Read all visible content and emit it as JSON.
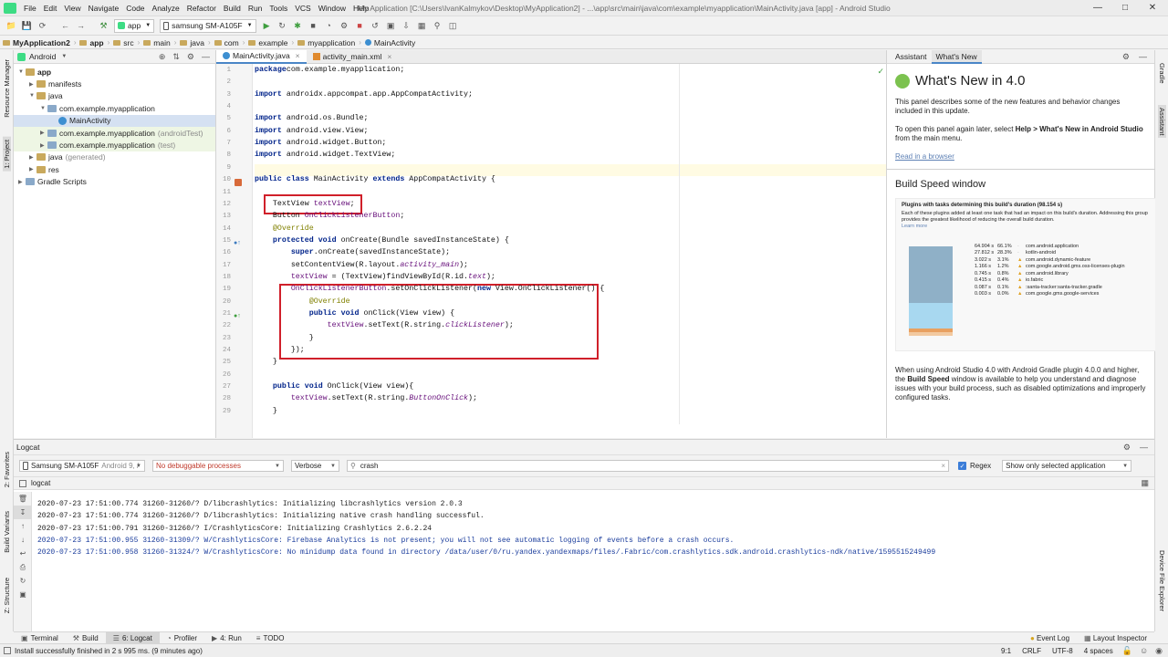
{
  "menu": [
    "File",
    "Edit",
    "View",
    "Navigate",
    "Code",
    "Analyze",
    "Refactor",
    "Build",
    "Run",
    "Tools",
    "VCS",
    "Window",
    "Help"
  ],
  "window_title": "My Application [C:\\Users\\IvanKalmykov\\Desktop\\MyApplication2] - ...\\app\\src\\main\\java\\com\\example\\myapplication\\MainActivity.java [app] - Android Studio",
  "toolbar": {
    "run_config": "app",
    "device": "samsung SM-A105F"
  },
  "breadcrumbs": [
    "MyApplication2",
    "app",
    "src",
    "main",
    "java",
    "com",
    "example",
    "myapplication",
    "MainActivity"
  ],
  "left_strip": [
    "Resource Manager",
    "1: Project",
    "2: Favorites",
    "Build Variants",
    "Z: Structure"
  ],
  "right_strip": [
    "Gradle",
    "Assistant",
    "Device File Explorer"
  ],
  "project": {
    "view_mode": "Android",
    "tree": [
      {
        "label": "app",
        "suffix": "",
        "depth": 0,
        "icon": "folder",
        "expanded": true,
        "bold": true
      },
      {
        "label": "manifests",
        "suffix": "",
        "depth": 1,
        "icon": "folder",
        "expanded": false
      },
      {
        "label": "java",
        "suffix": "",
        "depth": 1,
        "icon": "folder",
        "expanded": true
      },
      {
        "label": "com.example.myapplication",
        "suffix": "",
        "depth": 2,
        "icon": "folder",
        "expanded": true
      },
      {
        "label": "MainActivity",
        "suffix": "",
        "depth": 3,
        "icon": "class",
        "selected": true
      },
      {
        "label": "com.example.myapplication",
        "suffix": "(androidTest)",
        "depth": 2,
        "icon": "folder",
        "expanded": false,
        "green": true
      },
      {
        "label": "com.example.myapplication",
        "suffix": "(test)",
        "depth": 2,
        "icon": "folder",
        "expanded": false,
        "green": true
      },
      {
        "label": "java",
        "suffix": "(generated)",
        "depth": 1,
        "icon": "folder",
        "expanded": false
      },
      {
        "label": "res",
        "suffix": "",
        "depth": 1,
        "icon": "folder",
        "expanded": false
      },
      {
        "label": "Gradle Scripts",
        "suffix": "",
        "depth": 0,
        "icon": "gradle",
        "expanded": false
      }
    ]
  },
  "editor": {
    "tabs": [
      "MainActivity.java",
      "activity_main.xml"
    ],
    "active_tab": 0,
    "line_numbers": [
      "1",
      "2",
      "3",
      "4",
      "5",
      "6",
      "7",
      "8",
      "9",
      "10",
      "11",
      "12",
      "13",
      "14",
      "15",
      "16",
      "17",
      "18",
      "19",
      "20",
      "21",
      "22",
      "23",
      "24",
      "25",
      "26",
      "27",
      "28",
      "29"
    ]
  },
  "assistant": {
    "tabs": [
      "Assistant",
      "What's New"
    ],
    "title": "What's New in 4.0",
    "p1": "This panel describes some of the new features and behavior changes included in this update.",
    "p2_pre": "To open this panel again later, select ",
    "p2_bold": "Help > What's New in Android Studio",
    "p2_post": " from the main menu.",
    "link": "Read in a browser",
    "section": "Build Speed window",
    "fig_title": "Plugins with tasks determining this build's duration (98.154 s)",
    "fig_desc": "Each of these plugins added at least one task that had an impact on this build's duration. Addressing this group provides the greatest likelihood of reducing the overall build duration.",
    "fig_learn": "Learn more",
    "fig_rows": [
      {
        "t": "64.904 s",
        "p": "66.1%",
        "n": "com.android.application"
      },
      {
        "t": "27.812 s",
        "p": "28.3%",
        "n": "kotlin-android"
      },
      {
        "t": "3.022 s",
        "p": "3.1%",
        "n": "com.android.dynamic-feature"
      },
      {
        "t": "1.166 s",
        "p": "1.2%",
        "n": "com.google.android.gms.oss-licenses-plugin"
      },
      {
        "t": "0.745 s",
        "p": "0.8%",
        "n": "com.android.library"
      },
      {
        "t": "0.415 s",
        "p": "0.4%",
        "n": "io.fabric"
      },
      {
        "t": "0.087 s",
        "p": "0.1%",
        "n": ":santa-tracker:santa-tracker.gradle"
      },
      {
        "t": "0.003 s",
        "p": "0.0%",
        "n": "com.google.gms.google-services"
      }
    ],
    "p3_pre": "When using Android Studio 4.0 with Android Gradle plugin 4.0.0 and higher, the ",
    "p3_bold": "Build Speed",
    "p3_post": " window is available to help you understand and diagnose issues with your build process, such as disabled optimizations and improperly configured tasks."
  },
  "logcat": {
    "title": "Logcat",
    "device": "Samsung SM-A105F",
    "device_suffix": "Android 9, /",
    "process": "No debuggable processes",
    "level": "Verbose",
    "search": "crash",
    "regex_label": "Regex",
    "filter": "Show only selected application",
    "sub_tab": "logcat",
    "lines": [
      {
        "text": "2020-07-23 17:51:00.774 31260-31260/? D/libcrashlytics: Initializing libcrashlytics version 2.0.3",
        "color": "#1f1f1f"
      },
      {
        "text": "2020-07-23 17:51:00.774 31260-31260/? D/libcrashlytics: Initializing native crash handling successful.",
        "color": "#1f1f1f"
      },
      {
        "text": "2020-07-23 17:51:00.791 31260-31260/? I/CrashlyticsCore: Initializing Crashlytics 2.6.2.24",
        "color": "#1f1f1f"
      },
      {
        "text": "2020-07-23 17:51:00.955 31260-31309/? W/CrashlyticsCore: Firebase Analytics is not present; you will not see automatic logging of events before a crash occurs.",
        "color": "#1a3c9c"
      },
      {
        "text": "2020-07-23 17:51:00.958 31260-31324/? W/CrashlyticsCore: No minidump data found in directory /data/user/0/ru.yandex.yandexmaps/files/.Fabric/com.crashlytics.sdk.android.crashlytics-ndk/native/1595515249499",
        "color": "#1a3c9c"
      }
    ]
  },
  "tool_tabs": [
    "Terminal",
    "Build",
    "6: Logcat",
    "Profiler",
    "4: Run",
    "TODO"
  ],
  "tool_tabs_right": [
    "Event Log",
    "Layout Inspector"
  ],
  "status": {
    "message": "Install successfully finished in 2 s 995 ms. (9 minutes ago)",
    "position": "9:1",
    "line_sep": "CRLF",
    "encoding": "UTF-8",
    "indent": "4 spaces"
  },
  "colors": {
    "highlight_box": "#d0202a",
    "keyword": "#00238a",
    "field": "#660e7a"
  }
}
